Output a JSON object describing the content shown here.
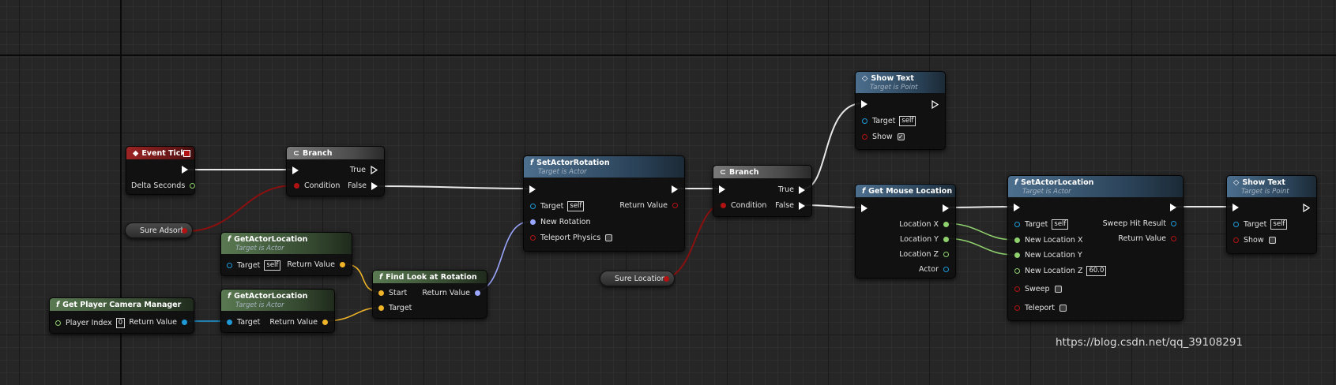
{
  "colors": {
    "exec": "#ffffff",
    "bool": "#b21212",
    "float": "#8fd16d",
    "object": "#1e9ad8",
    "vector": "#f0b428",
    "rotator": "#9aa6ff"
  },
  "nodes": {
    "event_tick": {
      "title": "Event Tick",
      "icon": "event-icon",
      "delta": "Delta Seconds"
    },
    "branch1": {
      "title": "Branch",
      "true": "True",
      "false": "False",
      "condition": "Condition"
    },
    "set_actor_rotation": {
      "title": "SetActorRotation",
      "subtitle": "Target is Actor",
      "target": "Target",
      "self": "self",
      "new_rotation": "New Rotation",
      "teleport": "Teleport Physics",
      "return": "Return Value"
    },
    "branch2": {
      "title": "Branch",
      "true": "True",
      "false": "False",
      "condition": "Condition"
    },
    "show_text1": {
      "title": "Show Text",
      "subtitle": "Target is Point",
      "target": "Target",
      "self": "self",
      "show": "Show",
      "show_checked": "✓"
    },
    "get_mouse_location": {
      "title": "Get Mouse Location",
      "loc_x": "Location X",
      "loc_y": "Location Y",
      "loc_z": "Location Z",
      "actor": "Actor"
    },
    "set_actor_location": {
      "title": "SetActorLocation",
      "subtitle": "Target is Actor",
      "target": "Target",
      "self": "self",
      "new_x": "New Location X",
      "new_y": "New Location Y",
      "new_z": "New Location Z",
      "new_z_val": "60.0",
      "sweep": "Sweep",
      "teleport": "Teleport",
      "sweep_hit": "Sweep Hit Result",
      "return": "Return Value"
    },
    "show_text2": {
      "title": "Show Text",
      "subtitle": "Target is Point",
      "target": "Target",
      "self": "self",
      "show": "Show"
    },
    "get_actor_location1": {
      "title": "GetActorLocation",
      "subtitle": "Target is Actor",
      "target": "Target",
      "self": "self",
      "return": "Return Value"
    },
    "get_actor_location2": {
      "title": "GetActorLocation",
      "subtitle": "Target is Actor",
      "target": "Target",
      "return": "Return Value"
    },
    "find_look_at": {
      "title": "Find Look at Rotation",
      "start": "Start",
      "target": "Target",
      "return": "Return Value"
    },
    "get_camera_mgr": {
      "title": "Get Player Camera Manager",
      "player_index": "Player Index",
      "player_index_val": "0",
      "return": "Return Value"
    }
  },
  "variables": {
    "sure_adsorb": "Sure Adsorb",
    "sure_location": "Sure Location"
  },
  "watermark": "https://blog.csdn.net/qq_39108291"
}
